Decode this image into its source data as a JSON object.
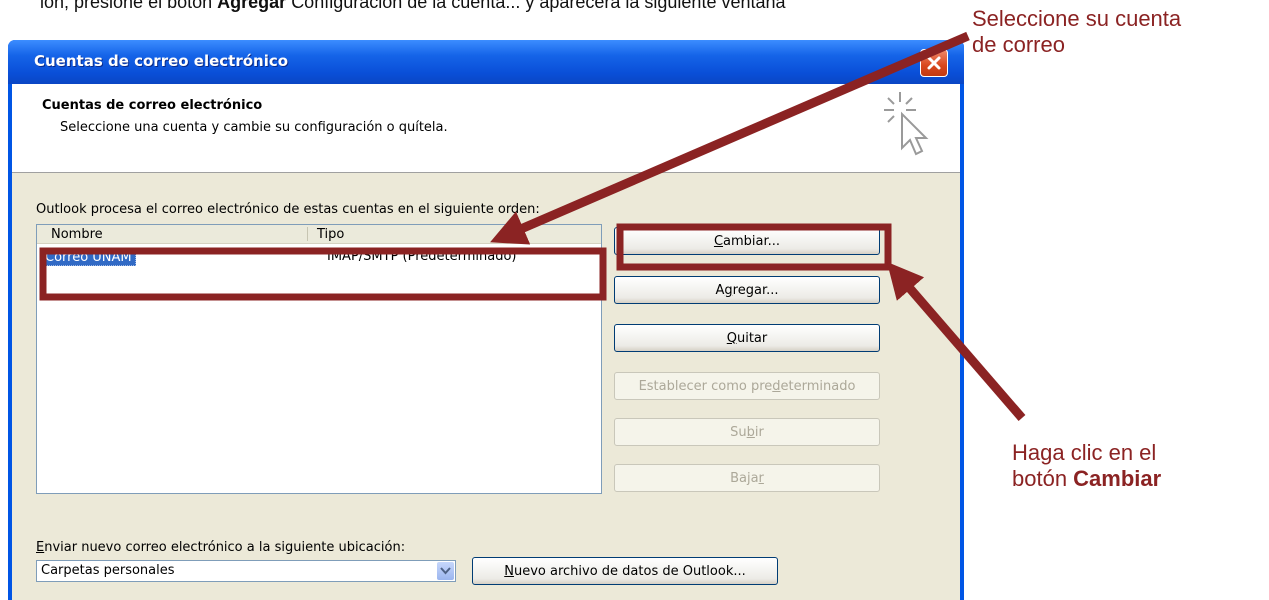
{
  "intro": {
    "text_a": "ión, presione el botón",
    "text_b": "Configuración de la cuenta... y aparecerá la siguiente ventana",
    "text_bold": "Agregar"
  },
  "window": {
    "title": "Cuentas de correo electrónico",
    "header": {
      "title": "Cuentas de correo electrónico",
      "subtitle": "Seleccione una cuenta y cambie su configuración o quítela."
    },
    "list_caption": "Outlook procesa el correo electrónico de estas cuentas en el siguiente orden:",
    "columns": {
      "name": "Nombre",
      "type": "Tipo"
    },
    "accounts": [
      {
        "name": "Correo UNAM",
        "type": "IMAP/SMTP (Predeterminado)"
      }
    ],
    "buttons": {
      "change": {
        "pre": "",
        "key": "C",
        "post": "ambiar..."
      },
      "add": {
        "pre": "A",
        "key": "g",
        "post": "regar..."
      },
      "remove": {
        "pre": "",
        "key": "Q",
        "post": "uitar"
      },
      "set_default": {
        "pre": "Establecer como pre",
        "key": "d",
        "post": "eterminado"
      },
      "up": {
        "pre": "Su",
        "key": "b",
        "post": "ir"
      },
      "down": {
        "pre": "Baja",
        "key": "r",
        "post": ""
      }
    },
    "send_label": {
      "key": "E",
      "post": "nviar nuevo correo electrónico a la siguiente ubicación:"
    },
    "location_value": "Carpetas personales",
    "new_file_button": {
      "key": "N",
      "post": "uevo archivo de datos de Outlook..."
    }
  },
  "annotations": {
    "select_account_line1": "Seleccione su cuenta",
    "select_account_line2": "de correo",
    "click_change_line1": "Haga clic en el",
    "click_change_plain": "botón ",
    "click_change_bold": "Cambiar",
    "color": "#8b2323"
  }
}
